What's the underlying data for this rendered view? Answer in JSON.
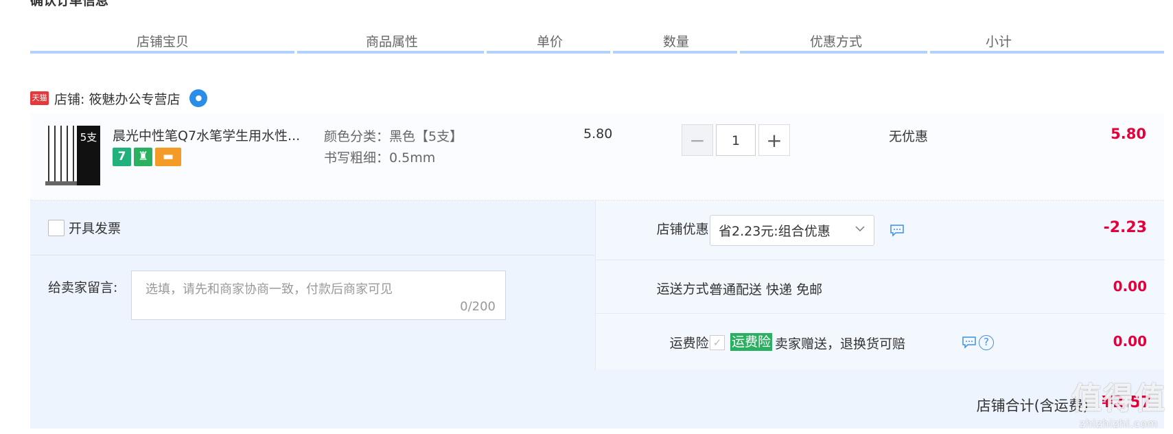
{
  "section_title": "确认订单信息",
  "columns": [
    "店铺宝贝",
    "商品属性",
    "单价",
    "数量",
    "优惠方式",
    "小计"
  ],
  "store": {
    "badge": "天猫",
    "label": "店铺: 筱魅办公专营店",
    "chat_icon": "wangwang-icon"
  },
  "item": {
    "title": "晨光中性笔Q7水笔学生用水性...",
    "thumb_text": "5支",
    "badges": [
      "7",
      "service",
      "card"
    ],
    "sku": [
      "颜色分类：黑色【5支】",
      "书写粗细：0.5mm"
    ],
    "unit_price": "5.80",
    "qty": "1",
    "qty_minus": "−",
    "qty_plus": "+",
    "discount": "无优惠",
    "subtotal": "5.80"
  },
  "invoice": {
    "label": "开具发票",
    "checked": false
  },
  "message": {
    "label": "给卖家留言:",
    "placeholder": "选填，请先和商家协商一致，付款后商家可见",
    "counter": "0/200"
  },
  "store_discount": {
    "label": "店铺优惠:",
    "selected": "省2.23元:组合优惠",
    "amount": "-2.23"
  },
  "shipping": {
    "label": "运送方式:",
    "value": "普通配送 快递 免邮",
    "amount": "0.00"
  },
  "insurance": {
    "label": "运费险:",
    "tag": "运费险",
    "text": "卖家赠送，退换货可赔",
    "amount": "0.00"
  },
  "total": {
    "label": "店铺合计(含运费)",
    "value": "¥2.57"
  },
  "watermark": {
    "big": "值得值",
    "small": "zhizhizhi.com"
  },
  "colors": {
    "price_red": "#e4003a",
    "header_line": "#b2d1ff",
    "panel_bg": "#eef4fd",
    "green_tag": "#2bb062"
  }
}
